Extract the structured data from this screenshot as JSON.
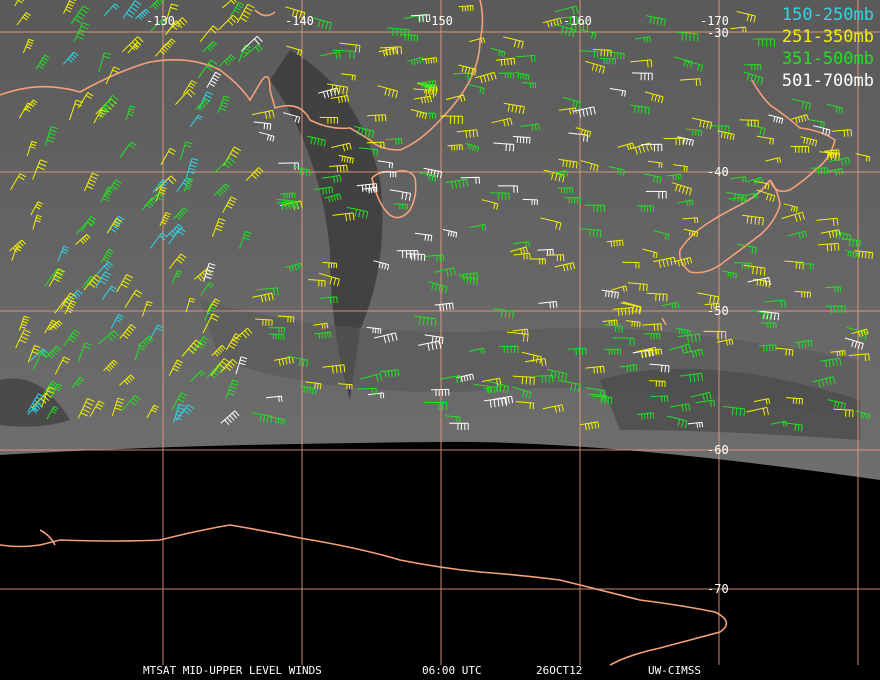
{
  "legend": [
    {
      "label": "150-250mb",
      "color": "#2fd6e6"
    },
    {
      "label": "251-350mb",
      "color": "#f2f200"
    },
    {
      "label": "351-500mb",
      "color": "#22e022"
    },
    {
      "label": "501-700mb",
      "color": "#ffffff"
    }
  ],
  "lon_labels": [
    "-130",
    "-140",
    "-150",
    "-160",
    "-170"
  ],
  "lat_labels": [
    "-30",
    "-40",
    "-50",
    "-60",
    "-70"
  ],
  "footer": {
    "product": "MTSAT MID-UPPER LEVEL WINDS",
    "time": "06:00 UTC",
    "date": "26OCT12",
    "source": "UW-CIMSS"
  },
  "colors": {
    "coast": "#f4a07a",
    "grid": "#e8a080"
  }
}
